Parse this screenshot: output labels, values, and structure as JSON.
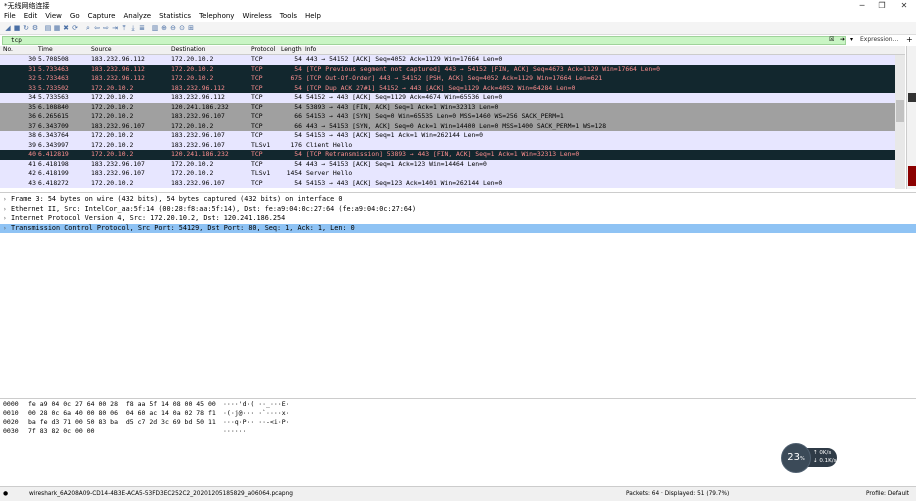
{
  "window": {
    "title": "*无线网络连接",
    "min": "─",
    "max": "❐",
    "close": "✕"
  },
  "menu": [
    "File",
    "Edit",
    "View",
    "Go",
    "Capture",
    "Analyze",
    "Statistics",
    "Telephony",
    "Wireless",
    "Tools",
    "Help"
  ],
  "toolbar_icons": [
    {
      "name": "shark-fin-start-icon",
      "glyph": "◢"
    },
    {
      "name": "stop-capture-icon",
      "glyph": "■"
    },
    {
      "name": "restart-capture-icon",
      "glyph": "↻"
    },
    {
      "name": "capture-options-icon",
      "glyph": "⚙"
    },
    {
      "name": "open-file-icon",
      "glyph": "▤"
    },
    {
      "name": "save-file-icon",
      "glyph": "▦"
    },
    {
      "name": "close-file-icon",
      "glyph": "✖"
    },
    {
      "name": "reload-icon",
      "glyph": "⟳"
    },
    {
      "name": "find-packet-icon",
      "glyph": "⌕"
    },
    {
      "name": "go-back-icon",
      "glyph": "⇦"
    },
    {
      "name": "go-forward-icon",
      "glyph": "⇨"
    },
    {
      "name": "go-to-packet-icon",
      "glyph": "⇥"
    },
    {
      "name": "first-packet-icon",
      "glyph": "⤒"
    },
    {
      "name": "last-packet-icon",
      "glyph": "⤓"
    },
    {
      "name": "autoscroll-icon",
      "glyph": "≣"
    },
    {
      "name": "colorize-icon",
      "glyph": "▥"
    },
    {
      "name": "zoom-in-icon",
      "glyph": "⊕"
    },
    {
      "name": "zoom-out-icon",
      "glyph": "⊖"
    },
    {
      "name": "zoom-reset-icon",
      "glyph": "⊙"
    },
    {
      "name": "resize-columns-icon",
      "glyph": "⊞"
    }
  ],
  "filter": {
    "value": "tcp",
    "expression_label": "Expression…",
    "plus": "+"
  },
  "columns": [
    "No.",
    "Time",
    "Source",
    "Destination",
    "Protocol",
    "Length",
    "Info"
  ],
  "colors": {
    "lavender": "#e7e6ff",
    "dark": "#12272e",
    "dark_fg": "#fd8e8e",
    "gray": "#a0a0a0",
    "selected": "#cfe3f7",
    "highlight": "#8fc3f4"
  },
  "packets": [
    {
      "no": "30",
      "time": "5.708508",
      "src": "183.232.96.112",
      "dst": "172.20.10.2",
      "proto": "TCP",
      "len": "54",
      "info": "443 → 54152 [ACK] Seq=4052 Ack=1129 Win=17664 Len=0",
      "style": "lavender"
    },
    {
      "no": "31",
      "time": "5.733463",
      "src": "183.232.96.112",
      "dst": "172.20.10.2",
      "proto": "TCP",
      "len": "54",
      "info": "[TCP Previous segment not captured] 443 → 54152 [FIN, ACK] Seq=4673 Ack=1129 Win=17664 Len=0",
      "style": "dark"
    },
    {
      "no": "32",
      "time": "5.733463",
      "src": "183.232.96.112",
      "dst": "172.20.10.2",
      "proto": "TCP",
      "len": "675",
      "info": "[TCP Out-Of-Order] 443 → 54152 [PSH, ACK] Seq=4052 Ack=1129 Win=17664 Len=621",
      "style": "dark"
    },
    {
      "no": "33",
      "time": "5.733502",
      "src": "172.20.10.2",
      "dst": "183.232.96.112",
      "proto": "TCP",
      "len": "54",
      "info": "[TCP Dup ACK 27#1] 54152 → 443 [ACK] Seq=1129 Ack=4052 Win=64284 Len=0",
      "style": "dark"
    },
    {
      "no": "34",
      "time": "5.733563",
      "src": "172.20.10.2",
      "dst": "183.232.96.112",
      "proto": "TCP",
      "len": "54",
      "info": "54152 → 443 [ACK] Seq=1129 Ack=4674 Win=65536 Len=0",
      "style": "lavender"
    },
    {
      "no": "35",
      "time": "6.108840",
      "src": "172.20.10.2",
      "dst": "120.241.186.232",
      "proto": "TCP",
      "len": "54",
      "info": "53893 → 443 [FIN, ACK] Seq=1 Ack=1 Win=32313 Len=0",
      "style": "gray"
    },
    {
      "no": "36",
      "time": "6.265615",
      "src": "172.20.10.2",
      "dst": "183.232.96.107",
      "proto": "TCP",
      "len": "66",
      "info": "54153 → 443 [SYN] Seq=0 Win=65535 Len=0 MSS=1460 WS=256 SACK_PERM=1",
      "style": "gray"
    },
    {
      "no": "37",
      "time": "6.343709",
      "src": "183.232.96.107",
      "dst": "172.20.10.2",
      "proto": "TCP",
      "len": "66",
      "info": "443 → 54153 [SYN, ACK] Seq=0 Ack=1 Win=14400 Len=0 MSS=1400 SACK_PERM=1 WS=128",
      "style": "gray"
    },
    {
      "no": "38",
      "time": "6.343764",
      "src": "172.20.10.2",
      "dst": "183.232.96.107",
      "proto": "TCP",
      "len": "54",
      "info": "54153 → 443 [ACK] Seq=1 Ack=1 Win=262144 Len=0",
      "style": "lavender"
    },
    {
      "no": "39",
      "time": "6.343997",
      "src": "172.20.10.2",
      "dst": "183.232.96.107",
      "proto": "TLSv1",
      "len": "176",
      "info": "Client Hello",
      "style": "lavender"
    },
    {
      "no": "40",
      "time": "6.412819",
      "src": "172.20.10.2",
      "dst": "120.241.186.232",
      "proto": "TCP",
      "len": "54",
      "info": "[TCP Retransmission] 53893 → 443 [FIN, ACK] Seq=1 Ack=1 Win=32313 Len=0",
      "style": "dark"
    },
    {
      "no": "41",
      "time": "6.418198",
      "src": "183.232.96.107",
      "dst": "172.20.10.2",
      "proto": "TCP",
      "len": "54",
      "info": "443 → 54153 [ACK] Seq=1 Ack=123 Win=14464 Len=0",
      "style": "lavender"
    },
    {
      "no": "42",
      "time": "6.418199",
      "src": "183.232.96.107",
      "dst": "172.20.10.2",
      "proto": "TLSv1",
      "len": "1454",
      "info": "Server Hello",
      "style": "lavender"
    },
    {
      "no": "43",
      "time": "6.418272",
      "src": "172.20.10.2",
      "dst": "183.232.96.107",
      "proto": "TCP",
      "len": "54",
      "info": "54153 → 443 [ACK] Seq=123 Ack=1401 Win=262144 Len=0",
      "style": "lavender"
    }
  ],
  "details": [
    {
      "text": "Frame 3: 54 bytes on wire (432 bits), 54 bytes captured (432 bits) on interface 0",
      "selected": false
    },
    {
      "text": "Ethernet II, Src: IntelCor_aa:5f:14 (00:28:f8:aa:5f:14), Dst: fe:a9:04:0c:27:64 (fe:a9:04:0c:27:64)",
      "selected": false
    },
    {
      "text": "Internet Protocol Version 4, Src: 172.20.10.2, Dst: 120.241.186.254",
      "selected": false
    },
    {
      "text": "Transmission Control Protocol, Src Port: 54129, Dst Port: 80, Seq: 1, Ack: 1, Len: 0",
      "selected": true
    }
  ],
  "bytes": [
    {
      "offset": "0000",
      "hex": "fe a9 04 0c 27 64 00 28  f8 aa 5f 14 08 00 45 00",
      "ascii": "····'d·( ··_···E·"
    },
    {
      "offset": "0010",
      "hex": "00 28 0c 6a 40 00 80 06  04 60 ac 14 0a 02 78 f1",
      "ascii": "·(·j@··· ·`····x·"
    },
    {
      "offset": "0020",
      "hex": "ba fe d3 71 00 50 83 ba  d5 c7 2d 3c 69 bd 50 11",
      "ascii": "···q·P·· ··-<i·P·"
    },
    {
      "offset": "0030",
      "hex": "7f 83 82 0c 00 00",
      "ascii": "······"
    }
  ],
  "status": {
    "file": "wireshark_6A208A09-CD14-4B3E-ACA5-53FD3EC252C2_20201205185829_a06064.pcapng",
    "packets": "Packets: 64 · Displayed: 51 (79.7%)",
    "profile": "Profile: Default"
  },
  "speed": {
    "percent": "23",
    "percent_unit": "%",
    "up": "0K/s",
    "down": "0.1K/s"
  }
}
